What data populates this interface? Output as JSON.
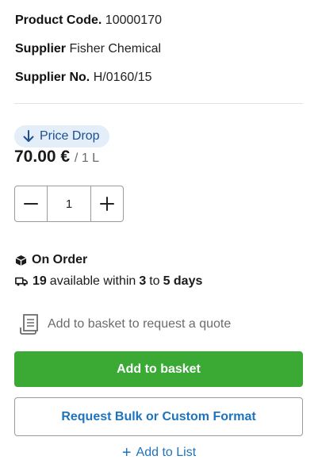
{
  "product": {
    "code_label": "Product Code.",
    "code_value": "10000170",
    "supplier_label": "Supplier",
    "supplier_value": "Fisher Chemical",
    "supplier_no_label": "Supplier No.",
    "supplier_no_value": "H/0160/15"
  },
  "pricing": {
    "badge_label": "Price Drop",
    "badge_icon": "arrow-down-icon",
    "price": "70.00 €",
    "unit": "/ 1 L"
  },
  "quantity": {
    "value": "1",
    "decrement_icon": "minus-icon",
    "increment_icon": "plus-icon"
  },
  "availability": {
    "status_icon": "package-icon",
    "status": "On Order",
    "delivery_icon": "truck-icon",
    "count": "19",
    "available_text": "available within",
    "min_days": "3",
    "to_text": "to",
    "max_days": "5 days"
  },
  "quote": {
    "icon": "quote-document-icon",
    "text": "Add to basket to request a quote"
  },
  "actions": {
    "add_to_basket": "Add to basket",
    "request_bulk": "Request Bulk or Custom Format",
    "add_to_list_symbol": "+",
    "add_to_list": "Add to List"
  },
  "colors": {
    "primary_green": "#3aaa35",
    "link_blue": "#1e73be",
    "badge_bg": "#e4eef9",
    "badge_text": "#1b4f8f"
  }
}
